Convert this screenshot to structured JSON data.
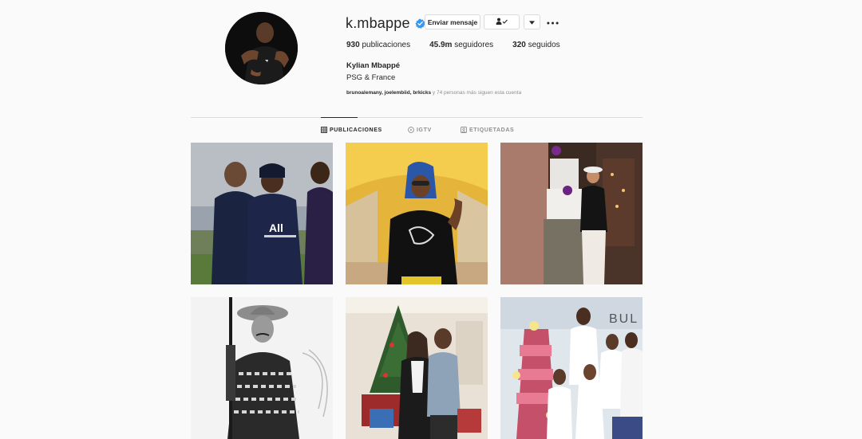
{
  "profile": {
    "username": "k.mbappe",
    "verified": true,
    "message_label": "Enviar mensaje",
    "following_icon": "person-check-icon",
    "dropdown_icon": "caret-down-icon",
    "more_icon": "ellipsis-icon",
    "stats": {
      "posts_count": "930",
      "posts_label": "publicaciones",
      "followers_count": "45.9m",
      "followers_label": "seguidores",
      "following_count": "320",
      "following_label": "seguidos"
    },
    "full_name": "Kylian Mbappé",
    "bio": "PSG & France",
    "followed_by": {
      "names": "brunoalemany, joelembiid, brkicks",
      "rest": " y 74 personas más siguen esta cuenta"
    }
  },
  "tabs": [
    {
      "label": "PUBLICACIONES",
      "icon": "grid-icon",
      "active": true
    },
    {
      "label": "IGTV",
      "icon": "igtv-icon",
      "active": false
    },
    {
      "label": "ETIQUETADAS",
      "icon": "tagged-icon",
      "active": false
    }
  ],
  "posts": [
    {
      "subject": "training-with-teammates"
    },
    {
      "subject": "desert-tent-portrait"
    },
    {
      "subject": "cake-celebration"
    },
    {
      "subject": "cowboy-bw-portrait"
    },
    {
      "subject": "christmas-tree-photo"
    },
    {
      "subject": "charity-event-kids"
    }
  ],
  "colors": {
    "background": "#fafafa",
    "border": "#dbdbdb",
    "verified": "#3897f0",
    "text": "#262626",
    "muted": "#8e8e8e"
  }
}
